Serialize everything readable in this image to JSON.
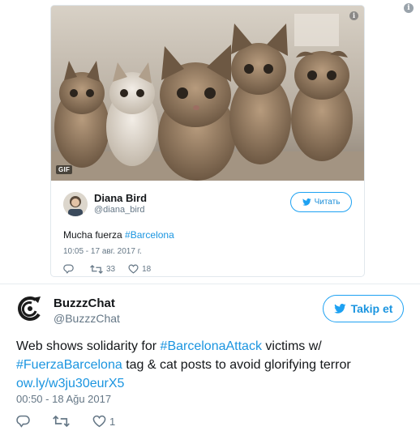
{
  "embed": {
    "media_badge": "GIF",
    "author_name": "Diana Bird",
    "author_handle": "@diana_bird",
    "follow_label": "Читать",
    "text_prefix": "Mucha fuerza ",
    "hashtag": "#Barcelona",
    "timestamp": "10:05 - 17 авг. 2017 г.",
    "retweet_count": "33",
    "like_count": "18"
  },
  "tweet": {
    "author_name": "BuzzzChat",
    "author_handle": "@BuzzzChat",
    "follow_label": "Takip et",
    "text": {
      "part1": "Web shows solidarity for ",
      "hashtag1": "#BarcelonaAttack",
      "part2": " victims w/ ",
      "hashtag2": "#FuerzaBarcelona",
      "part3": " tag & cat posts to avoid glorifying terror ",
      "link": "ow.ly/w3ju30eurX5"
    },
    "timestamp": "00:50 - 18 Ağu 2017",
    "like_count": "1"
  },
  "colors": {
    "link": "#1b95e0",
    "text": "#14171a",
    "secondary": "#657786",
    "border": "#e1e8ed"
  },
  "icons": [
    "info-icon",
    "twitter-bird-icon",
    "reply-icon",
    "retweet-icon",
    "heart-icon",
    "buzzzchat-logo"
  ]
}
